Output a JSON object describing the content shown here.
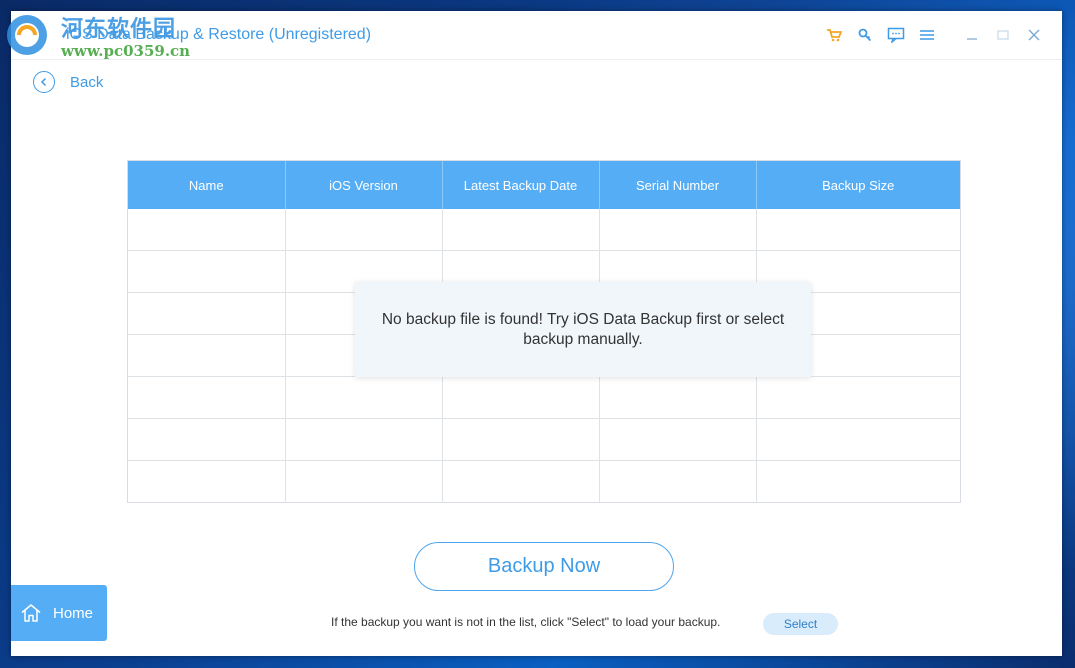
{
  "window": {
    "title": "iOS Data Backup & Restore (Unregistered)",
    "watermark_cn": "河东软件园",
    "watermark_url": "www.pc0359.cn"
  },
  "titlebar_icons": [
    "cart-icon",
    "key-icon",
    "feedback-icon",
    "menu-icon",
    "minimize-icon",
    "maximize-icon",
    "close-icon"
  ],
  "nav": {
    "back_label": "Back"
  },
  "table": {
    "columns": [
      "Name",
      "iOS Version",
      "Latest Backup Date",
      "Serial Number",
      "Backup Size"
    ],
    "empty_rows": 7
  },
  "empty_message": "No backup file is found! Try iOS Data Backup first or select backup manually.",
  "actions": {
    "backup_now_label": "Backup Now",
    "hint": "If the backup you want is not in the list, click \"Select\" to load your backup.",
    "select_label": "Select",
    "home_label": "Home"
  },
  "colors": {
    "accent": "#3f9be6",
    "header_blue": "#55aef5",
    "cart_orange": "#f5a623"
  }
}
